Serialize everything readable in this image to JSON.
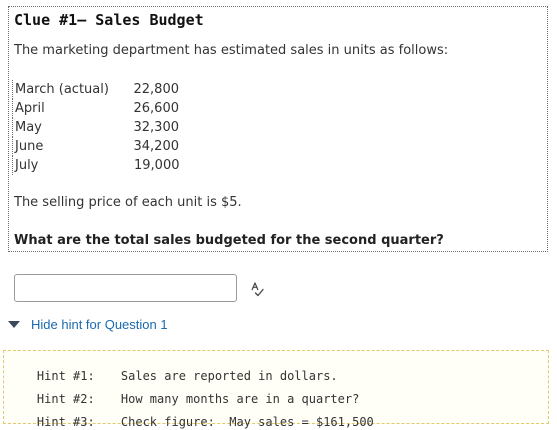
{
  "clue": {
    "title": "Clue #1– Sales Budget",
    "intro": "The marketing department has estimated sales in units as follows:",
    "sales": [
      {
        "month": "March (actual)",
        "units": "22,800"
      },
      {
        "month": "April",
        "units": "26,600"
      },
      {
        "month": "May",
        "units": "32,300"
      },
      {
        "month": "June",
        "units": "34,200"
      },
      {
        "month": "July",
        "units": "19,000"
      }
    ],
    "price_text": "The selling price of each unit is $5.",
    "question": "What are the total sales budgeted for the second quarter?"
  },
  "answer": {
    "value": "",
    "placeholder": ""
  },
  "icons": {
    "spellcheck": "spellcheck-icon",
    "toggle": "caret-down-icon"
  },
  "hint_toggle": {
    "label": "Hide hint for Question 1"
  },
  "hints": [
    {
      "key": "Hint #1:",
      "text": "Sales are reported in dollars."
    },
    {
      "key": "Hint #2:",
      "text": "How many months are in a quarter?"
    },
    {
      "key": "Hint #3:",
      "text": "Check figure:  May sales = $161,500"
    }
  ],
  "colors": {
    "link": "#1a6ab0",
    "hint_border": "#e2c96a",
    "text": "#333333"
  }
}
